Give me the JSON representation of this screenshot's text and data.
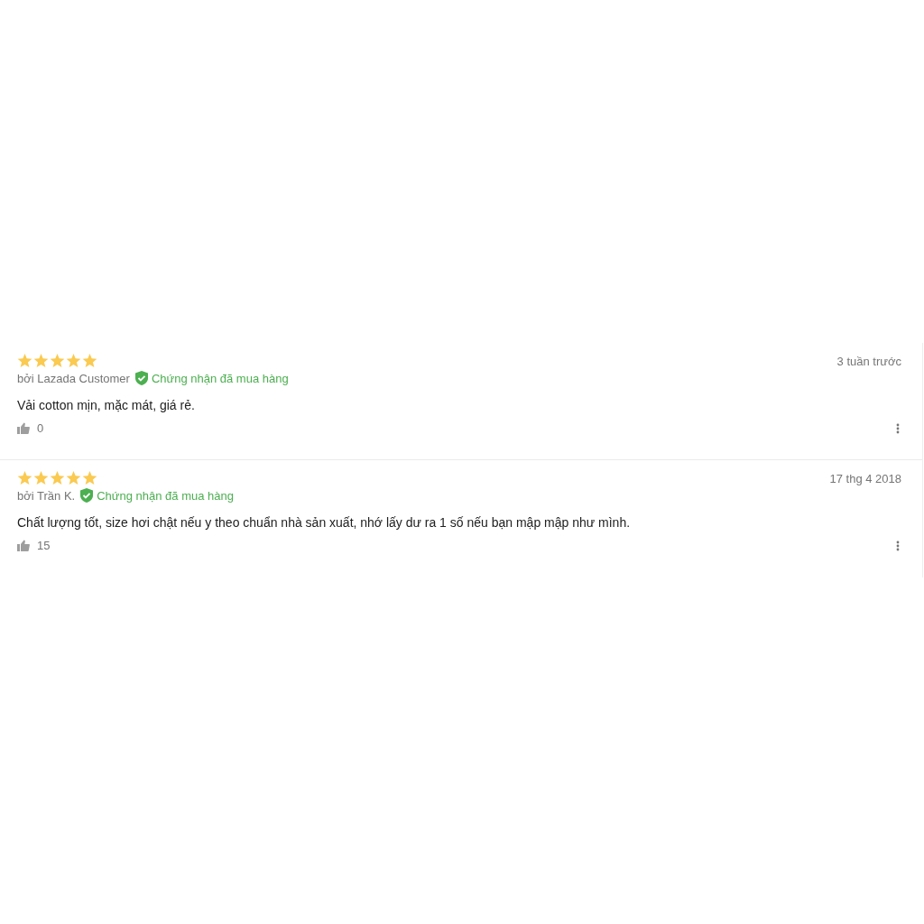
{
  "reviews": [
    {
      "stars": 5,
      "date": "3 tuần trước",
      "author": "bởi Lazada Customer",
      "verified": true,
      "verified_label": "Chứng nhận đã mua hàng",
      "text": "Vải cotton mịn, mặc mát, giá rẻ.",
      "likes": "0"
    },
    {
      "stars": 5,
      "date": "17 thg 4 2018",
      "author": "bởi Trần K.",
      "verified": true,
      "verified_label": "Chứng nhận đã mua hàng",
      "text": "Chất lượng tốt, size hơi chật nếu y theo chuẩn nhà sản xuất, nhớ lấy dư ra 1 số nếu bạn mập mập như mình.",
      "likes": "15"
    }
  ]
}
